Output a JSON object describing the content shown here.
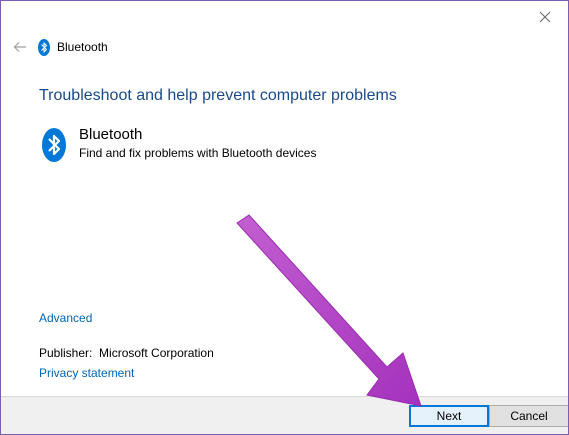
{
  "window": {
    "title": "Bluetooth"
  },
  "icons": {
    "close": "close-icon",
    "back": "back-arrow-icon",
    "bluetooth": "bluetooth-icon"
  },
  "colors": {
    "accent": "#0078d7",
    "heading": "#1a4a8a",
    "link": "#0066b4",
    "annotation_arrow": "#b146c2"
  },
  "main": {
    "heading": "Troubleshoot and help prevent computer problems",
    "troubleshooter": {
      "name": "Bluetooth",
      "description": "Find and fix problems with Bluetooth devices"
    },
    "advanced_link": "Advanced",
    "publisher_label": "Publisher:",
    "publisher_value": "Microsoft Corporation",
    "privacy_link": "Privacy statement"
  },
  "footer": {
    "next_label": "Next",
    "cancel_label": "Cancel"
  }
}
